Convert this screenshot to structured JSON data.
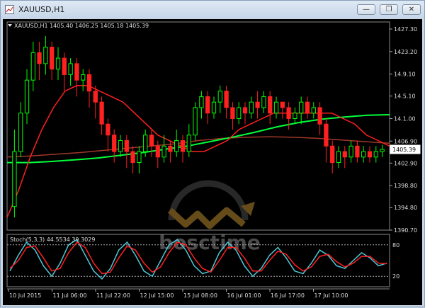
{
  "window": {
    "title": "XAUUSD,H1",
    "buttons": {
      "minimize": "—",
      "restore": "❐",
      "close": "✕"
    }
  },
  "chart_data": [
    {
      "type": "candlestick",
      "info": "XAUUSD,H1  1405.40 1406.25 1405.18 1405.39",
      "ylim": [
        1390.7,
        1427.3
      ],
      "yticks": [
        "1427.30",
        "1423.20",
        "14.9.10",
        "14.5.10",
        "14.1.00",
        "1406.90",
        "1402.90",
        "1398.80",
        "1394.80",
        "1390.70"
      ],
      "current_price_label": "1405.39",
      "current_price": 1405.39,
      "xlabels": [
        "10 Jul 2015",
        "11 Jul 06:00",
        "11 Jul 22:00",
        "12 Jul 15:00",
        "15 Jul 08:00",
        "16 Jul 01:00",
        "16 Jul 17:00",
        "17 Jul 10:00"
      ],
      "colors": {
        "up": "#00ff00",
        "down": "#ff2020",
        "ma_fast": "#ff2020",
        "ma_slow": "#00ff3a",
        "ma_brown": "#a0382a"
      },
      "candles": [
        [
          1395,
          1405,
          1393,
          1409
        ],
        [
          1405,
          1412,
          1404,
          1414
        ],
        [
          1412,
          1418,
          1410,
          1420
        ],
        [
          1418,
          1423,
          1416,
          1425
        ],
        [
          1423,
          1421,
          1418,
          1425
        ],
        [
          1421,
          1424,
          1419,
          1426
        ],
        [
          1424,
          1420,
          1418,
          1425
        ],
        [
          1420,
          1422,
          1418,
          1424
        ],
        [
          1422,
          1419,
          1416,
          1423
        ],
        [
          1419,
          1421,
          1417,
          1422
        ],
        [
          1421,
          1418,
          1415,
          1422
        ],
        [
          1418,
          1419,
          1416,
          1420
        ],
        [
          1419,
          1416,
          1413,
          1420
        ],
        [
          1416,
          1414,
          1411,
          1417
        ],
        [
          1414,
          1410,
          1408,
          1415
        ],
        [
          1410,
          1408,
          1405,
          1411
        ],
        [
          1408,
          1405,
          1403,
          1409
        ],
        [
          1405,
          1407,
          1404,
          1408
        ],
        [
          1407,
          1405,
          1402,
          1408
        ],
        [
          1405,
          1403,
          1401,
          1406
        ],
        [
          1403,
          1405,
          1401,
          1406
        ],
        [
          1405,
          1408,
          1404,
          1409
        ],
        [
          1408,
          1406,
          1404,
          1409
        ],
        [
          1406,
          1404,
          1402,
          1407
        ],
        [
          1404,
          1406,
          1403,
          1408
        ],
        [
          1406,
          1405,
          1403,
          1407
        ],
        [
          1405,
          1407,
          1404,
          1409
        ],
        [
          1407,
          1405,
          1403,
          1408
        ],
        [
          1405,
          1408,
          1404,
          1410
        ],
        [
          1408,
          1413,
          1407,
          1414
        ],
        [
          1413,
          1415,
          1411,
          1416
        ],
        [
          1415,
          1412,
          1410,
          1416
        ],
        [
          1412,
          1414,
          1411,
          1415
        ],
        [
          1414,
          1416,
          1412,
          1417
        ],
        [
          1416,
          1413,
          1411,
          1417
        ],
        [
          1413,
          1411,
          1409,
          1414
        ],
        [
          1411,
          1413,
          1410,
          1414
        ],
        [
          1413,
          1412,
          1410,
          1414
        ],
        [
          1412,
          1414,
          1411,
          1415
        ],
        [
          1414,
          1413,
          1411,
          1416
        ],
        [
          1413,
          1415,
          1412,
          1416
        ],
        [
          1415,
          1412,
          1410,
          1416
        ],
        [
          1412,
          1414,
          1411,
          1415
        ],
        [
          1414,
          1413,
          1411,
          1414
        ],
        [
          1413,
          1411,
          1409,
          1414
        ],
        [
          1411,
          1412,
          1410,
          1413
        ],
        [
          1412,
          1414,
          1410,
          1415
        ],
        [
          1414,
          1412,
          1411,
          1415
        ],
        [
          1412,
          1413,
          1411,
          1414
        ],
        [
          1413,
          1410,
          1408,
          1414
        ],
        [
          1410,
          1406,
          1403,
          1411
        ],
        [
          1406,
          1403,
          1401,
          1407
        ],
        [
          1403,
          1405,
          1402,
          1406
        ],
        [
          1405,
          1404,
          1402,
          1406
        ],
        [
          1404,
          1406,
          1403,
          1407
        ],
        [
          1406,
          1404,
          1403,
          1407
        ],
        [
          1404,
          1405,
          1403,
          1406
        ],
        [
          1405,
          1404,
          1403,
          1406
        ],
        [
          1404,
          1405,
          1403,
          1406
        ],
        [
          1405,
          1405.39,
          1404,
          1406.25
        ]
      ],
      "ma_fast": [
        1393,
        1398,
        1404,
        1409,
        1413,
        1416,
        1417,
        1417,
        1416,
        1415,
        1414,
        1412,
        1410,
        1408,
        1407,
        1406,
        1405,
        1405,
        1406,
        1407,
        1409,
        1410,
        1411,
        1412,
        1412,
        1412,
        1412,
        1412,
        1412,
        1411,
        1410,
        1408,
        1407,
        1406
      ],
      "ma_slow": [
        1403,
        1403,
        1403.2,
        1403.5,
        1403.8,
        1404.3,
        1404.8,
        1405.4,
        1406,
        1406.8,
        1407.6,
        1408.5,
        1409.5,
        1410.3,
        1410.9,
        1411.3,
        1411.6,
        1411.7
      ],
      "ma_brown": [
        1404,
        1404.2,
        1404.5,
        1404.8,
        1405.2,
        1405.6,
        1406,
        1406.4,
        1407,
        1407.4,
        1407.6,
        1407.7,
        1407.6,
        1407.4,
        1407.1,
        1406.8,
        1406.5
      ],
      "stochastic": {
        "label": "Stoch(5,3,3) 44.5534 39.3029",
        "levels": [
          "80",
          "20"
        ],
        "k": [
          30,
          60,
          85,
          70,
          40,
          20,
          45,
          80,
          90,
          60,
          30,
          15,
          35,
          70,
          85,
          60,
          30,
          20,
          50,
          80,
          90,
          70,
          40,
          25,
          30,
          65,
          85,
          70,
          40,
          20,
          35,
          60,
          75,
          55,
          30,
          25,
          45,
          70,
          60,
          40,
          35,
          50,
          65,
          55,
          40,
          45
        ],
        "d": [
          35,
          50,
          75,
          78,
          55,
          30,
          35,
          65,
          85,
          75,
          45,
          25,
          28,
          55,
          78,
          70,
          45,
          28,
          38,
          65,
          85,
          80,
          55,
          35,
          28,
          50,
          75,
          75,
          55,
          30,
          30,
          50,
          68,
          62,
          42,
          30,
          38,
          58,
          62,
          48,
          38,
          45,
          58,
          58,
          45,
          44
        ]
      }
    }
  ],
  "watermark": {
    "text": "bosctime"
  }
}
